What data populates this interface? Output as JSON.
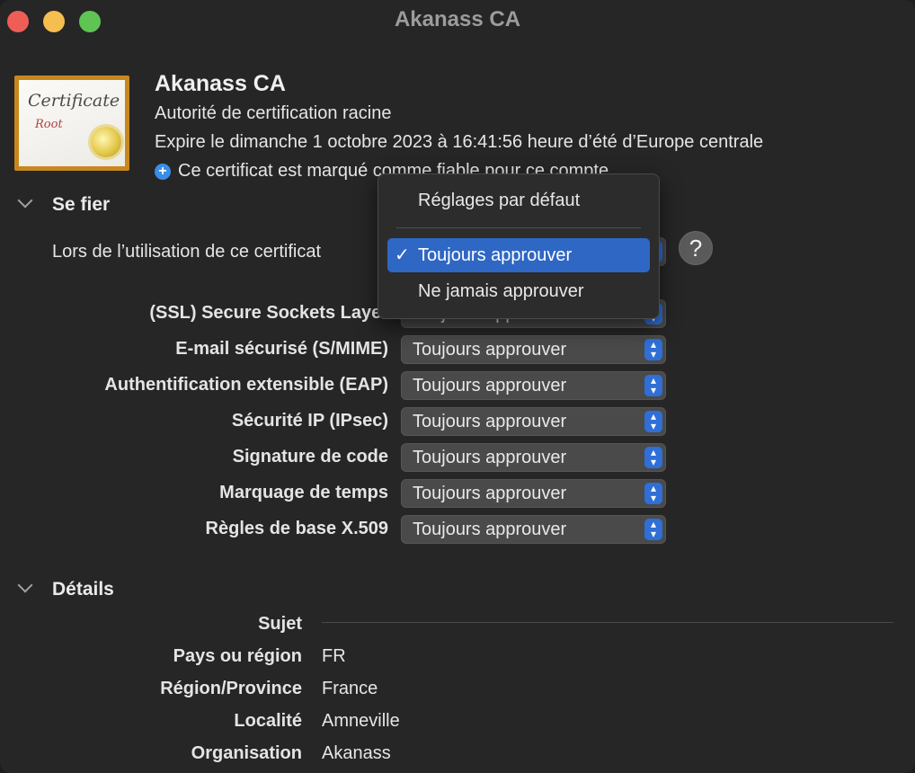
{
  "window": {
    "title": "Akanass CA"
  },
  "certificate": {
    "icon_text": "Certificate",
    "icon_subtext": "Root",
    "name": "Akanass CA",
    "type": "Autorité de certification racine",
    "expiry": "Expire le dimanche 1 octobre 2023 à 16:41:56 heure d’été d’Europe centrale",
    "trust_status": "Ce certificat est marqué comme fiable pour ce compte"
  },
  "trust": {
    "section_title": "Se fier",
    "when_using_label": "Lors de l’utilisation de ce certificat",
    "help_label": "?",
    "rows": [
      {
        "label": "(SSL) Secure Sockets Layer",
        "value": "Toujours approuver"
      },
      {
        "label": "E-mail sécurisé (S/MIME)",
        "value": "Toujours approuver"
      },
      {
        "label": "Authentification extensible (EAP)",
        "value": "Toujours approuver"
      },
      {
        "label": "Sécurité IP (IPsec)",
        "value": "Toujours approuver"
      },
      {
        "label": "Signature de code",
        "value": "Toujours approuver"
      },
      {
        "label": "Marquage de temps",
        "value": "Toujours approuver"
      },
      {
        "label": "Règles de base X.509",
        "value": "Toujours approuver"
      }
    ]
  },
  "dropdown_menu": {
    "items": [
      {
        "label": "Réglages par défaut",
        "selected": false
      },
      {
        "label": "Toujours approuver",
        "selected": true
      },
      {
        "label": "Ne jamais approuver",
        "selected": false
      }
    ],
    "check_glyph": "✓"
  },
  "details": {
    "section_title": "Détails",
    "subject_label": "Sujet",
    "fields": [
      {
        "label": "Pays ou région",
        "value": "FR"
      },
      {
        "label": "Région/Province",
        "value": "France"
      },
      {
        "label": "Localité",
        "value": "Amneville"
      },
      {
        "label": "Organisation",
        "value": "Akanass"
      }
    ]
  },
  "colors": {
    "accent": "#2f67c4",
    "window_bg": "#262626",
    "close": "#ee5e57",
    "minimize": "#f5be4f",
    "maximize": "#5fc454"
  }
}
